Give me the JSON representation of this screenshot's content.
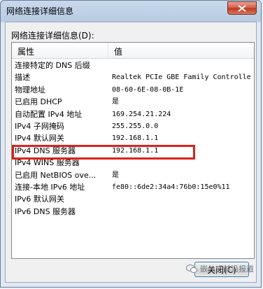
{
  "window": {
    "title": "网络连接详细信息",
    "close_glyph": "close-icon"
  },
  "details_label": "网络连接详细信息(D):",
  "table": {
    "columns": [
      "属性",
      "值"
    ],
    "rows": [
      {
        "property": "连接特定的 DNS 后缀",
        "value": ""
      },
      {
        "property": "描述",
        "value": "Realtek PCIe GBE Family Controlle"
      },
      {
        "property": "物理地址",
        "value": "08-60-6E-08-0B-1E"
      },
      {
        "property": "已启用 DHCP",
        "value": "是"
      },
      {
        "property": "自动配置 IPv4 地址",
        "value": "169.254.21.224"
      },
      {
        "property": "IPv4 子网掩码",
        "value": "255.255.0.0"
      },
      {
        "property": "IPv4 默认网关",
        "value": "192.168.1.1"
      },
      {
        "property": "IPv4 DNS 服务器",
        "value": "192.168.1.1"
      },
      {
        "property": "IPv4 WINS 服务器",
        "value": ""
      },
      {
        "property": "已启用 NetBIOS ove...",
        "value": "是"
      },
      {
        "property": "连接-本地 IPv6 地址",
        "value": "fe80::6de2:34a4:76b0:15e0%11"
      },
      {
        "property": "IPv6 默认网关",
        "value": ""
      },
      {
        "property": "IPv6 DNS 服务器",
        "value": ""
      }
    ]
  },
  "buttons": {
    "close_label": "关闭(C)"
  },
  "watermark": {
    "text": "嵌入式前沿报道"
  },
  "colors": {
    "highlight": "#d9241c",
    "titlebar": "#c9d9ec"
  }
}
